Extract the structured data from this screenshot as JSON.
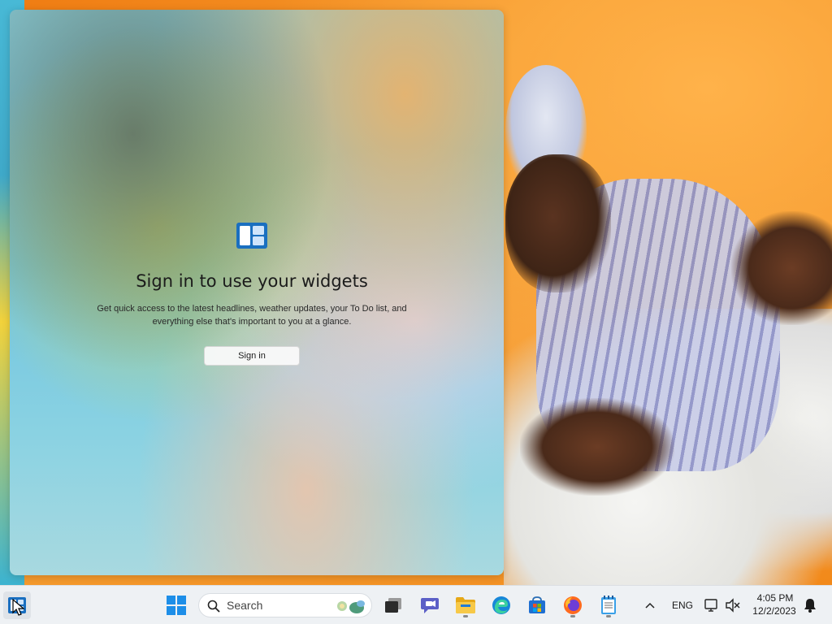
{
  "widgets_panel": {
    "title": "Sign in to use your widgets",
    "description_line1": "Get quick access to the latest headlines, weather updates, your To Do list, and",
    "description_line2": "everything else that's important to you at a glance.",
    "signin_label": "Sign in",
    "logo_icon": "widgets-icon"
  },
  "taskbar": {
    "search_placeholder": "Search",
    "apps": [
      {
        "name": "start-button",
        "icon": "windows-logo-icon"
      },
      {
        "name": "task-view",
        "icon": "task-view-icon"
      },
      {
        "name": "teams-chat",
        "icon": "chat-icon"
      },
      {
        "name": "file-explorer",
        "icon": "folder-icon"
      },
      {
        "name": "edge-browser",
        "icon": "edge-icon"
      },
      {
        "name": "microsoft-store",
        "icon": "store-icon"
      },
      {
        "name": "firefox",
        "icon": "firefox-icon"
      },
      {
        "name": "notepad",
        "icon": "notepad-icon"
      }
    ],
    "tray": {
      "language": "ENG",
      "time": "4:05 PM",
      "date": "12/2/2023"
    }
  },
  "colors": {
    "accent": "#0067c0",
    "taskbar_bg": "#eef1f4"
  }
}
